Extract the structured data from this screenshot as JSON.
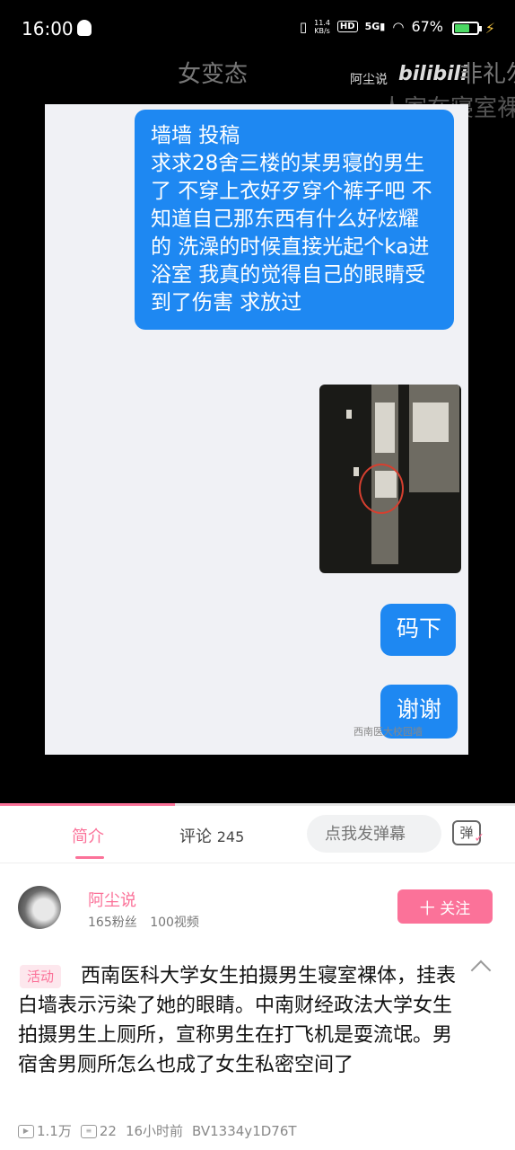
{
  "status_bar": {
    "time": "16:00",
    "net_speed_value": "11.4",
    "net_speed_unit": "KB/s",
    "hd_label": "HD",
    "signal_label": "5G",
    "battery_percent": "67%",
    "battery_level": 0.67,
    "battery_color": "#4cd964"
  },
  "video": {
    "overlay_left_text": "女变态",
    "watermark_user": "阿尘说",
    "bili_logo": "bilibili",
    "overlay_right_line1": "非礼勿",
    "overlay_right_line2": "人家在寝室裸",
    "chat_bubble_main": "墙墙 投稿\n求求28舍三楼的某男寝的男生了 不穿上衣好歹穿个裤子吧 不知道自己那东西有什么好炫耀的 洗澡的时候直接光起个ka进浴室 我真的觉得自己的眼睛受到了伤害 求放过",
    "chat_bubble_2": "码下",
    "chat_bubble_3": "谢谢",
    "chat_watermark": "西南医大校园墙",
    "progress": 0.34,
    "progress_color": "#fb7299"
  },
  "tabs": {
    "intro_label": "简介",
    "comments_label": "评论",
    "comments_count": "245",
    "danmaku_placeholder": "点我发弹幕",
    "danmaku_toggle_label": "弹"
  },
  "uploader": {
    "name": "阿尘说",
    "fans": "165粉丝",
    "videos": "100视频",
    "follow_label": "十 关注"
  },
  "video_info": {
    "tag": "活动",
    "title": "西南医科大学女生拍摄男生寝室裸体，挂表白墙表示污染了她的眼睛。中南财经政法大学女生拍摄男生上厕所，宣称男生在打飞机是耍流氓。男宿舍男厕所怎么也成了女生私密空间了",
    "views": "1.1万",
    "danmaku_count": "22",
    "time_ago": "16小时前",
    "bvid": "BV1334y1D76T"
  }
}
